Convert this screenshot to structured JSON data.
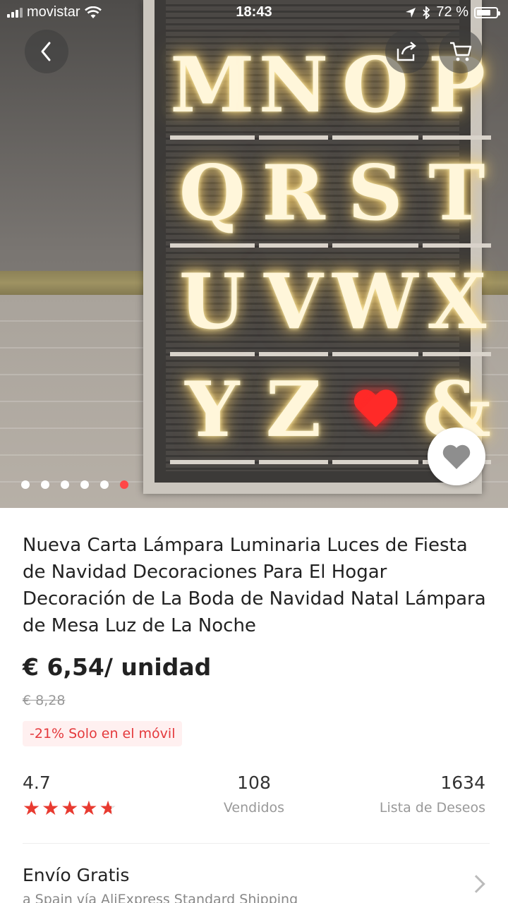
{
  "status_bar": {
    "carrier": "movistar",
    "time": "18:43",
    "battery": "72 %",
    "battery_level": 0.72
  },
  "gallery": {
    "letters": [
      "M",
      "N",
      "O",
      "P",
      "Q",
      "R",
      "S",
      "T",
      "U",
      "V",
      "W",
      "X",
      "Y",
      "Z",
      "heart",
      "&"
    ],
    "image_count": 6,
    "active_index": 5
  },
  "icons": {
    "back": "chevron-left-icon",
    "share": "share-icon",
    "cart": "cart-icon",
    "favorite": "heart-icon"
  },
  "product": {
    "title": "Nueva Carta Lámpara Luminaria Luces de Fiesta de Navidad Decoraciones Para El Hogar Decoración de La Boda de Navidad Natal Lámpara de Mesa Luz de La Noche",
    "price": "€ 6,54/ unidad",
    "original_price": "€ 8,28",
    "promo": "-21% Solo en el móvil"
  },
  "stats": {
    "rating": "4.7",
    "rating_value": 4.7,
    "sold_count": "108",
    "sold_label": "Vendidos",
    "wishlist_count": "1634",
    "wishlist_label": "Lista de Deseos"
  },
  "shipping": {
    "title": "Envío Gratis",
    "subtitle": "a Spain vía AliExpress Standard Shipping"
  },
  "colors": {
    "accent": "#e83a30",
    "dot_active": "#ff4747",
    "promo_bg": "#fff0f0"
  }
}
